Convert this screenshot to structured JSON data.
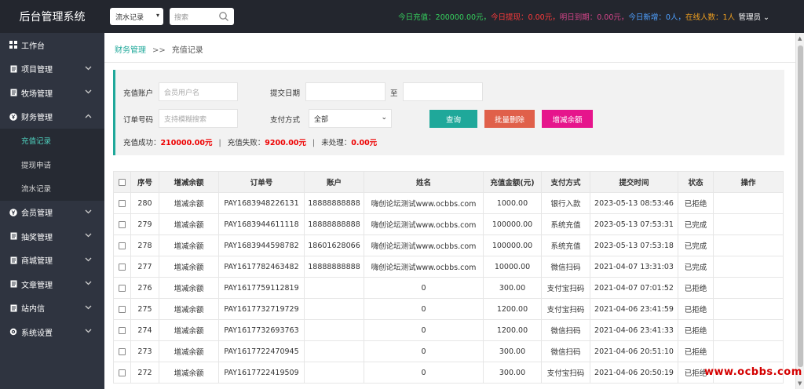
{
  "app": {
    "title": "后台管理系统"
  },
  "topbar": {
    "type_select": "流水记录",
    "search_placeholder": "搜索",
    "stats": [
      {
        "label": "今日充值：",
        "value": "200000.00元，",
        "color": "#36d05e"
      },
      {
        "label": "今日提现：",
        "value": "0.00元，",
        "color": "#ff3b3b"
      },
      {
        "label": "明日到期：",
        "value": "0.00元，",
        "color": "#d6458a"
      },
      {
        "label": "今日新增：",
        "value": "0人，",
        "color": "#4fa0ff"
      },
      {
        "label": "在线人数：",
        "value": "1人",
        "color": "#f0a020"
      }
    ],
    "admin": "管理员"
  },
  "sidebar": {
    "items": [
      {
        "label": "工作台",
        "icon": "dashboard-icon",
        "has_chevron": false
      },
      {
        "label": "项目管理",
        "icon": "doc-icon",
        "has_chevron": true
      },
      {
        "label": "牧场管理",
        "icon": "doc-icon",
        "has_chevron": true
      },
      {
        "label": "财务管理",
        "icon": "finance-icon",
        "has_chevron": true,
        "expanded": true
      },
      {
        "label": "会员管理",
        "icon": "finance-icon",
        "has_chevron": true
      },
      {
        "label": "抽奖管理",
        "icon": "doc-icon",
        "has_chevron": true
      },
      {
        "label": "商城管理",
        "icon": "doc-icon",
        "has_chevron": true
      },
      {
        "label": "文章管理",
        "icon": "doc-icon",
        "has_chevron": true
      },
      {
        "label": "站内信",
        "icon": "doc-icon",
        "has_chevron": true
      },
      {
        "label": "系统设置",
        "icon": "gear-icon",
        "has_chevron": true
      }
    ],
    "sub_items": [
      "充值记录",
      "提现申请",
      "流水记录"
    ]
  },
  "breadcrumb": {
    "root": "财务管理",
    "sep": ">>",
    "current": "充值记录"
  },
  "filter": {
    "account_label": "充值账户",
    "account_placeholder": "会员用户名",
    "date_label": "提交日期",
    "date_to": "至",
    "order_label": "订单号码",
    "order_placeholder": "支持模糊搜索",
    "pay_label": "支付方式",
    "pay_value": "全部",
    "btn_query": "查询",
    "btn_batch_delete": "批量删除",
    "btn_adjust": "增减余额"
  },
  "summary": {
    "success_label": "充值成功：",
    "success_value": "210000.00元",
    "fail_label": "充值失败：",
    "fail_value": "9200.00元",
    "pending_label": "未处理：",
    "pending_value": "0.00元",
    "sep": "|"
  },
  "table": {
    "headers": [
      "",
      "序号",
      "增减余额",
      "订单号",
      "账户",
      "姓名",
      "充值金额(元)",
      "支付方式",
      "提交时间",
      "状态",
      "操作"
    ],
    "rows": [
      {
        "id": "280",
        "adjust": "增减余额",
        "order": "PAY1683948226131",
        "account": "18888888888",
        "name": "嗨创论坛测试www.ocbbs.com",
        "amount": "1000.00",
        "method": "银行入款",
        "time": "2023-05-13 08:53:46",
        "status": "已拒绝"
      },
      {
        "id": "279",
        "adjust": "增减余额",
        "order": "PAY1683944611118",
        "account": "18888888888",
        "name": "嗨创论坛测试www.ocbbs.com",
        "amount": "100000.00",
        "method": "系统充值",
        "time": "2023-05-13 07:53:31",
        "status": "已完成"
      },
      {
        "id": "278",
        "adjust": "增减余额",
        "order": "PAY1683944598782",
        "account": "18601628066",
        "name": "嗨创论坛测试www.ocbbs.com",
        "amount": "100000.00",
        "method": "系统充值",
        "time": "2023-05-13 07:53:18",
        "status": "已完成"
      },
      {
        "id": "277",
        "adjust": "增减余额",
        "order": "PAY1617782463482",
        "account": "18888888888",
        "name": "嗨创论坛测试www.ocbbs.com",
        "amount": "10000.00",
        "method": "微信扫码",
        "time": "2021-04-07 13:31:03",
        "status": "已完成"
      },
      {
        "id": "276",
        "adjust": "增减余额",
        "order": "PAY1617759112819",
        "account": "",
        "name": "0",
        "amount": "300.00",
        "method": "支付宝扫码",
        "time": "2021-04-07 07:01:52",
        "status": "已拒绝"
      },
      {
        "id": "275",
        "adjust": "增减余额",
        "order": "PAY1617732719729",
        "account": "",
        "name": "0",
        "amount": "1200.00",
        "method": "支付宝扫码",
        "time": "2021-04-06 23:41:59",
        "status": "已拒绝"
      },
      {
        "id": "274",
        "adjust": "增减余额",
        "order": "PAY1617732693763",
        "account": "",
        "name": "0",
        "amount": "1200.00",
        "method": "微信扫码",
        "time": "2021-04-06 23:41:33",
        "status": "已拒绝"
      },
      {
        "id": "273",
        "adjust": "增减余额",
        "order": "PAY1617722470945",
        "account": "",
        "name": "0",
        "amount": "300.00",
        "method": "微信扫码",
        "time": "2021-04-06 20:51:10",
        "status": "已拒绝"
      },
      {
        "id": "272",
        "adjust": "增减余额",
        "order": "PAY1617722419509",
        "account": "",
        "name": "0",
        "amount": "300.00",
        "method": "支付宝扫码",
        "time": "2021-04-06 20:50:19",
        "status": "已拒绝"
      }
    ]
  },
  "watermark": "www.ocbbs.com",
  "colors": {
    "accent": "#1fa89a",
    "danger": "#e0604a",
    "pink": "#e6158c",
    "topbar": "#23262e",
    "sidebar": "#2f3440"
  }
}
